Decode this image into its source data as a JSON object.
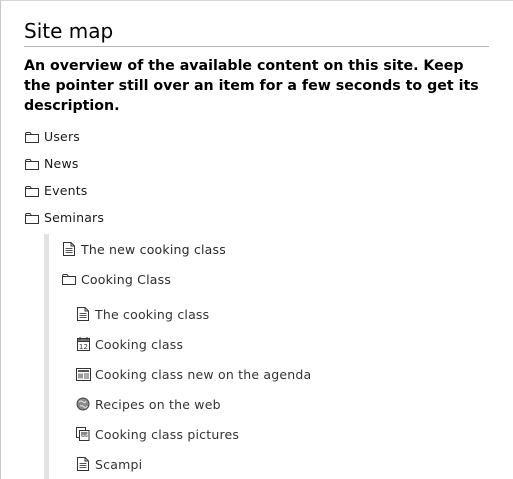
{
  "page": {
    "title": "Site map",
    "description": "An overview of the available content on this site. Keep the pointer still over an item for a few seconds to get its description."
  },
  "tree": [
    {
      "label": "Users",
      "icon": "folder-icon"
    },
    {
      "label": "News",
      "icon": "folder-icon"
    },
    {
      "label": "Events",
      "icon": "folder-icon"
    },
    {
      "label": "Seminars",
      "icon": "folder-icon",
      "children": [
        {
          "label": "The new cooking class",
          "icon": "document-icon"
        },
        {
          "label": "Cooking Class",
          "icon": "folder-icon",
          "children": [
            {
              "label": "The cooking class",
              "icon": "document-icon"
            },
            {
              "label": "Cooking class",
              "icon": "calendar-icon"
            },
            {
              "label": "Cooking class new on the agenda",
              "icon": "news-item-icon"
            },
            {
              "label": "Recipes on the web",
              "icon": "link-icon"
            },
            {
              "label": "Cooking class pictures",
              "icon": "image-icon"
            },
            {
              "label": "Scampi",
              "icon": "document-icon"
            }
          ]
        }
      ]
    }
  ]
}
